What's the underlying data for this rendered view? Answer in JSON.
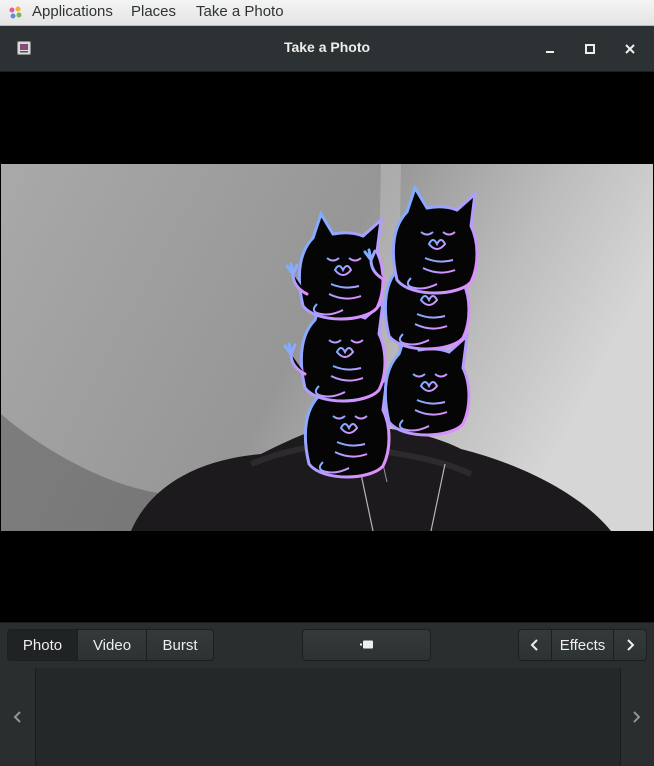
{
  "top_panel": {
    "applications_label": "Applications",
    "places_label": "Places",
    "app_label": "Take a Photo"
  },
  "window": {
    "title": "Take a Photo"
  },
  "toolbar": {
    "modes": [
      "Photo",
      "Video",
      "Burst"
    ],
    "active_mode": "Photo",
    "effects_label": "Effects"
  },
  "icons": {
    "app_menu": "applications-icon",
    "window": "cheese-app-icon",
    "minimize": "minimize-icon",
    "maximize": "maximize-icon",
    "close": "close-icon",
    "shutter": "camera-shutter-icon",
    "effects_prev": "chevron-left-icon",
    "effects_next": "chevron-right-icon",
    "strip_prev": "chevron-left-icon",
    "strip_next": "chevron-right-icon"
  },
  "colors": {
    "panel_bg": "#ececec",
    "titlebar_bg": "#2c3133",
    "toolbar_bg": "#2b2e2f",
    "neon_blue": "#6fb3ff",
    "neon_pink": "#e98bff"
  }
}
